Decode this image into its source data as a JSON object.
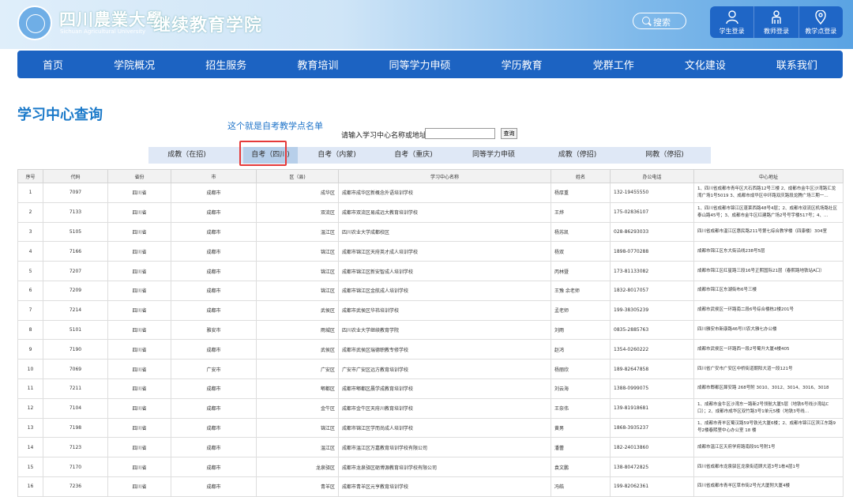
{
  "header": {
    "uni_name_cn": "四川農業大學",
    "uni_name_en": "Sichuan Agricultural University",
    "college_name": "继续教育学院",
    "search_placeholder": "搜索",
    "logins": [
      {
        "label": "学生登录",
        "icon": "student-icon"
      },
      {
        "label": "教师登录",
        "icon": "teacher-icon"
      },
      {
        "label": "教学点登录",
        "icon": "location-pin-icon"
      }
    ]
  },
  "nav": [
    "首页",
    "学院概况",
    "招生服务",
    "教育培训",
    "同等学力申硕",
    "学历教育",
    "党群工作",
    "文化建设",
    "联系我们"
  ],
  "page_title": "学习中心查询",
  "annotation": "这个就是自考教学点名单",
  "query": {
    "label": "请输入学习中心名称或地址：",
    "value": "",
    "button": "查询"
  },
  "tabs": [
    {
      "label": "成教（在招)",
      "active": false
    },
    {
      "label": "自考（四川)",
      "active": true
    },
    {
      "label": "自考（内蒙)",
      "active": false
    },
    {
      "label": "自考（重庆)",
      "active": false
    },
    {
      "label": "同等学力申硕",
      "active": false
    },
    {
      "label": "成教（停招)",
      "active": false
    },
    {
      "label": "网教（停招)",
      "active": false
    }
  ],
  "table": {
    "headers": [
      "序号",
      "代码",
      "省份",
      "市",
      "区（县)",
      "学习中心名称",
      "姓名",
      "办公电话",
      "中心地址"
    ],
    "rows": [
      [
        "1",
        "7097",
        "四川省",
        "成都市",
        "成华区",
        "成都市成华区新概念外语培训学校",
        "杨厚重",
        "132-19455550",
        "1、四川省成都市青年区大石西路12号三楼 2、成都市金牛区沙湾路汇龙湾广场1号5019 3、成都市成华区中环路双庆路段龙腾广场三期一…"
      ],
      [
        "2",
        "7133",
        "四川省",
        "成都市",
        "双流区",
        "成都市双流区易成远大教育培训学校",
        "王烨",
        "175-02836107",
        "1、四川省成都市锦江区蓬莱西路48号4层；2、成都市双流区机场路社区泰山路45号；3、成都市金牛区红建路广场2号号宇楼517号；4、…"
      ],
      [
        "3",
        "5105",
        "四川省",
        "成都市",
        "温江区",
        "四川农业大学成都校区",
        "杨苏凯",
        "028-86293033",
        "四川省成都市温江区惠民路211号第七综合教学楼（四康楼）304室"
      ],
      [
        "4",
        "7166",
        "四川省",
        "成都市",
        "锦江区",
        "成都市锦江区天府英才成人培训学校",
        "杨双",
        "1898-0770288",
        "成都市锦江区东大街沿线238号5层"
      ],
      [
        "5",
        "7207",
        "四川省",
        "成都市",
        "锦江区",
        "成都市锦江区新安智成人培训学校",
        "丙林暨",
        "173-81133082",
        "成都市锦江区红星路三段16号正熙国际21层（春熙路地铁站A口）"
      ],
      [
        "6",
        "7209",
        "四川省",
        "成都市",
        "锦江区",
        "成都市锦江区金航成人培训学校",
        "王豫 余老师",
        "1832-8017057",
        "成都市锦江区东湖街布6号三楼"
      ],
      [
        "7",
        "7214",
        "四川省",
        "成都市",
        "武侯区",
        "成都市武侯区华祎培训学校",
        "孟老师",
        "199-38305239",
        "成都市武侯区一环路南二段6号综合楼栋2楼201号"
      ],
      [
        "8",
        "5101",
        "四川省",
        "雅安市",
        "雨城区",
        "四川农业大学继续教育学院",
        "刘雨",
        "0835-2885763",
        "四川雅安市新康路46号川农大雅七办公楼"
      ],
      [
        "9",
        "7190",
        "四川省",
        "成都市",
        "武侯区",
        "成都市武侯区瑞德职教专修学校",
        "赵鸿",
        "1354-0260222",
        "成都市武侯区一环路西一段2号蜀升大厦4楼405"
      ],
      [
        "10",
        "7069",
        "四川省",
        "广安市",
        "广安区",
        "广安市广安区远方教育培训学校",
        "杨丽欣",
        "189-82647858",
        "四川省广安市广安区中桥街道朝阳大道一段121号"
      ],
      [
        "11",
        "7211",
        "四川省",
        "成都市",
        "郫都区",
        "成都市郫都区晨学成教育培训学校",
        "刘云海",
        "1388-0999075",
        "成都市郫都区犀安路 268号附 3010、3012、3014、3016、3018"
      ],
      [
        "12",
        "7104",
        "四川省",
        "成都市",
        "金牛区",
        "成都市金牛区天府川教育培训学校",
        "王奈伟",
        "139-81918681",
        "1、成都市金牛区沙湾东一路新2号领航大厦5层（地铁6号线沙湾站C口）；2、成都市成华区双竹路3号1单元5楼（地铁3号线…"
      ],
      [
        "13",
        "7198",
        "四川省",
        "成都市",
        "锦江区",
        "成都市锦江区学而尚成人培训学校",
        "黄男",
        "1868-3935237",
        "1、成都市青羊区蜀汉路59号铁光大厦6楼；2、成都市锦江区滨江东路9号2楼春熙里中心办公室 18 楼"
      ],
      [
        "14",
        "7123",
        "四川省",
        "成都市",
        "温江区",
        "成都市温江区万嘉教育培训学校有限公司",
        "潘蕾",
        "182-24013860",
        "成都市温江区天府学府路南段91号附1号"
      ],
      [
        "15",
        "7170",
        "四川省",
        "成都市",
        "龙泉驿区",
        "成都市龙泉驿区砺博源教育培训学校有限公司",
        "袁文鹏",
        "138-80472825",
        "四川省成都市龙泉驿区龙泉街道顾大道3号1栋4层1号"
      ],
      [
        "16",
        "7236",
        "四川省",
        "成都市",
        "青羊区",
        "成都市青羊区元亨教育培训学校",
        "冯皓",
        "199-82062361",
        "四川省成都市青羊区草市街2号光大厦附大厦4楼"
      ]
    ]
  },
  "colors": {
    "nav_bg": "#1c63c2",
    "title": "#1a79c9",
    "highlight": "#e53a3a",
    "tab_bar": "#dfe8f6"
  }
}
